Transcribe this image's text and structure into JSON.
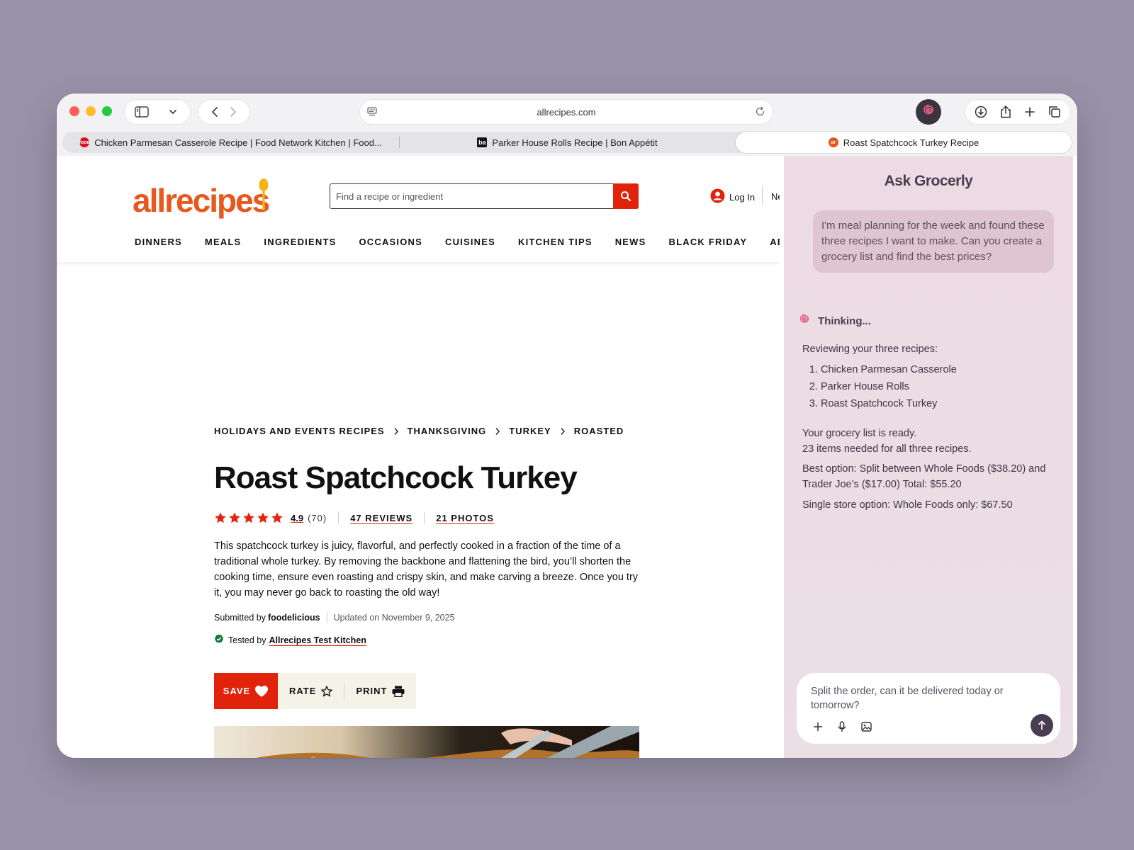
{
  "browser": {
    "url": "allrecipes.com",
    "tabs": [
      {
        "label": "Chicken Parmesan Casserole Recipe | Food Network Kitchen | Food...",
        "favicon": "food"
      },
      {
        "label": "Parker House Rolls Recipe | Bon Appétit",
        "favicon": "ba"
      },
      {
        "label": "Roast Spatchcock Turkey Recipe",
        "favicon": "ar"
      }
    ]
  },
  "site": {
    "logo": "allrecipes",
    "search_placeholder": "Find a recipe or ingredient",
    "login": "Log In",
    "header_cut": "Ne",
    "nav": [
      "DINNERS",
      "MEALS",
      "INGREDIENTS",
      "OCCASIONS",
      "CUISINES",
      "KITCHEN TIPS",
      "NEWS",
      "BLACK FRIDAY",
      "ABOUT US"
    ]
  },
  "recipe": {
    "breadcrumb": [
      "HOLIDAYS AND EVENTS RECIPES",
      "THANKSGIVING",
      "TURKEY",
      "ROASTED"
    ],
    "title": "Roast Spatchcock Turkey",
    "rating": "4.9",
    "rating_count": "(70)",
    "stars": 5,
    "reviews": "47 REVIEWS",
    "photos": "21 PHOTOS",
    "description": "This spatchcock turkey is juicy, flavorful, and perfectly cooked in a fraction of the time of a traditional whole turkey. By removing the backbone and flattening the bird, you’ll shorten the cooking time, ensure even roasting and crispy skin, and make carving a breeze. Once you try it, you may never go back to roasting the old way!",
    "submitted_label": "Submitted by",
    "author": "foodelicious",
    "updated": "Updated on November 9, 2025",
    "tested_label": "Tested by",
    "tested_by": "Allrecipes Test Kitchen",
    "actions": {
      "save": "SAVE",
      "rate": "RATE",
      "print": "PRINT"
    }
  },
  "assistant": {
    "title": "Ask Grocerly",
    "user_message": "I'm meal planning for the week and found these three recipes I want to make. Can you create a grocery list and find the best prices?",
    "thinking": "Thinking...",
    "intro": "Reviewing your three recipes:",
    "recipes": [
      "Chicken Parmesan Casserole",
      "Parker House Rolls",
      "Roast Spatchcock Turkey"
    ],
    "ready_line1": "Your grocery list is ready.",
    "ready_line2": "23 items needed for all three recipes.",
    "best_option": "Best option: Split between Whole Foods ($38.20) and Trader Joe’s ($17.00) Total: $55.20",
    "single_option": "Single store option: Whole Foods only: $67.50",
    "input_value": "Split the order, can it be delivered today or tomorrow?"
  },
  "colors": {
    "brand": "#e8571e",
    "accent_red": "#e1230b",
    "panel_bg": "#eddbe3",
    "panel_text": "#4a3d52",
    "desktop_bg": "#9891a8"
  }
}
